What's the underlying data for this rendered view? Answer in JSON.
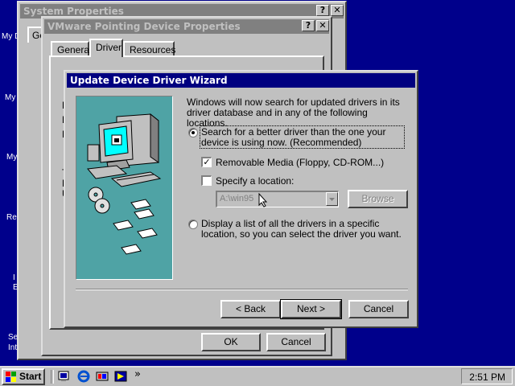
{
  "desktop": {
    "icon_labels": [
      "My D",
      "My",
      "My",
      "Re",
      "I",
      "E",
      "Se",
      "Int"
    ]
  },
  "system_properties": {
    "title": "System Properties",
    "help_button": "?",
    "close_button": "✕",
    "tab_fragment": "Ge"
  },
  "vmware_properties": {
    "title": "VMware Pointing Device Properties",
    "help_button": "?",
    "close_button": "✕",
    "tabs": [
      "General",
      "Driver",
      "Resources"
    ],
    "partial_letters": [
      "D",
      "D",
      "D",
      "T",
      "D",
      "U"
    ],
    "ok_label": "OK",
    "cancel_label": "Cancel"
  },
  "wizard": {
    "title": "Update Device Driver Wizard",
    "intro_text": "Windows will now search for updated drivers in its driver database and in any of the following locations.",
    "option_search_label": "Search for a better driver than the one your device is using now. (Recommended)",
    "option_search_selected": true,
    "removable_media_label": "Removable Media (Floppy, CD-ROM...)",
    "removable_media_checked": true,
    "specify_location_label": "Specify a location:",
    "specify_location_checked": false,
    "location_value": "A:\\win95",
    "browse_label": "Browse",
    "option_list_label": "Display a list of all the drivers in a specific location, so you can select the driver you want.",
    "option_list_selected": false,
    "back_label": "< Back",
    "next_label": "Next >",
    "cancel_label": "Cancel"
  },
  "taskbar": {
    "start_label": "Start",
    "more_arrows": "»",
    "clock": "2:51 PM"
  },
  "colors": {
    "desktop": "#00008b",
    "active_title": "#000080",
    "inactive_title": "#808080",
    "wizard_art_bg": "#4fa3a5"
  }
}
